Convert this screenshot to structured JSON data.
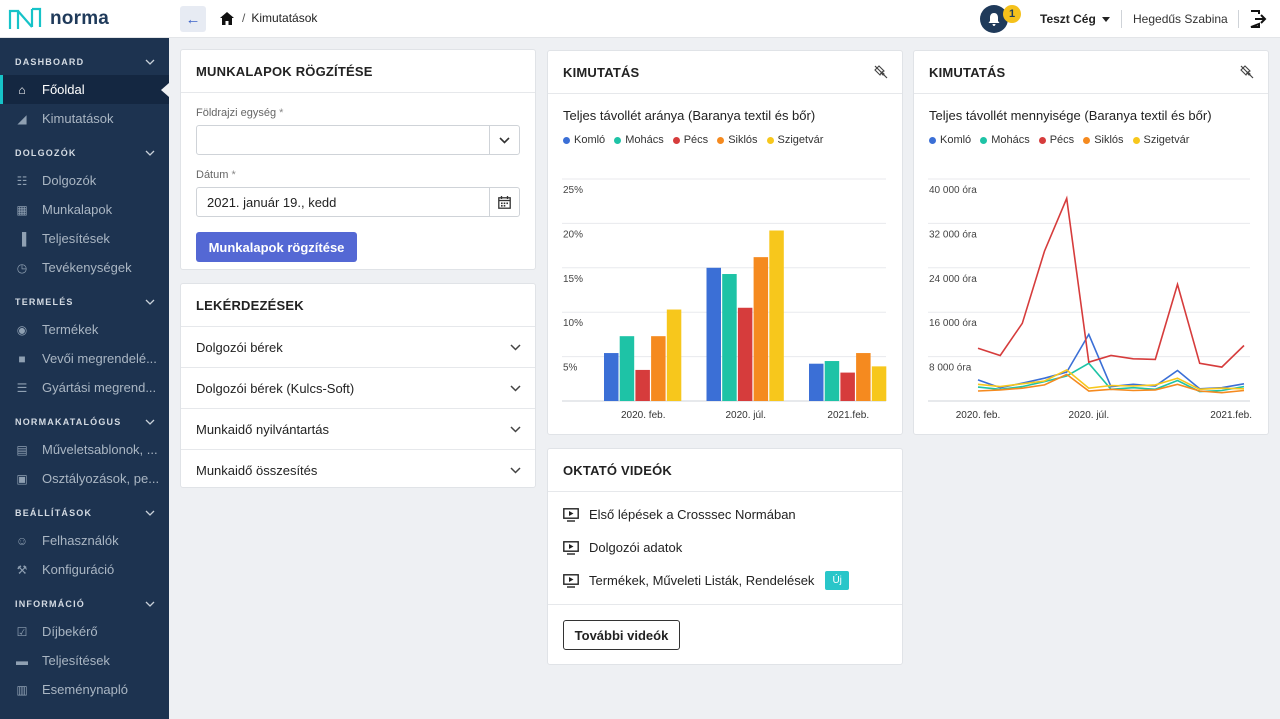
{
  "header": {
    "brand": "norma",
    "breadcrumb": "Kimutatások",
    "notification_count": "1",
    "company": "Teszt Cég",
    "user": "Hegedűs Szabina"
  },
  "sidebar": {
    "sections": [
      {
        "title": "DASHBOARD",
        "items": [
          {
            "label": "Főoldal",
            "icon": "home-icon",
            "active": true
          },
          {
            "label": "Kimutatások",
            "icon": "chart-area-icon"
          }
        ]
      },
      {
        "title": "DOLGOZÓK",
        "items": [
          {
            "label": "Dolgozók",
            "icon": "users-icon"
          },
          {
            "label": "Munkalapok",
            "icon": "calendar-icon"
          },
          {
            "label": "Teljesítések",
            "icon": "bar-chart-icon"
          },
          {
            "label": "Tevékenységek",
            "icon": "clock-icon"
          }
        ]
      },
      {
        "title": "TERMELÉS",
        "items": [
          {
            "label": "Termékek",
            "icon": "box-icon"
          },
          {
            "label": "Vevői megrendelé...",
            "icon": "file-icon"
          },
          {
            "label": "Gyártási megrend...",
            "icon": "list-icon"
          }
        ]
      },
      {
        "title": "NORMAKATALÓGUS",
        "items": [
          {
            "label": "Műveletsablonok, ...",
            "icon": "template-icon"
          },
          {
            "label": "Osztályozások, pe...",
            "icon": "classify-icon"
          }
        ]
      },
      {
        "title": "BEÁLLÍTÁSOK",
        "items": [
          {
            "label": "Felhasználók",
            "icon": "user-plus-icon"
          },
          {
            "label": "Konfiguráció",
            "icon": "wrench-icon"
          }
        ]
      },
      {
        "title": "INFORMÁCIÓ",
        "items": [
          {
            "label": "Díjbekérő",
            "icon": "invoice-icon"
          },
          {
            "label": "Teljesítések",
            "icon": "inbox-icon"
          },
          {
            "label": "Eseménynapló",
            "icon": "log-icon"
          }
        ]
      }
    ]
  },
  "worksheet": {
    "title": "MUNKALAPOK RÖGZÍTÉSE",
    "geo_label": "Földrajzi egység",
    "geo_value": "",
    "date_label": "Dátum",
    "date_value": "2021. január 19., kedd",
    "required_mark": "*",
    "submit": "Munkalapok rögzítése"
  },
  "queries": {
    "title": "LEKÉRDEZÉSEK",
    "items": [
      "Dolgozói bérek",
      "Dolgozói bérek (Kulcs-Soft)",
      "Munkaidő nyilvántartás",
      "Munkaidő összesítés"
    ]
  },
  "colors": {
    "Komló": "#3b6fd6",
    "Mohács": "#1ec3a6",
    "Pécs": "#d63c3c",
    "Siklós": "#f58a1f",
    "Szigetvár": "#f7c71c"
  },
  "chart_data": [
    {
      "type": "bar",
      "card_title": "KIMUTATÁS",
      "title": "Teljes távollét aránya (Baranya textil és bőr)",
      "categories": [
        "2020. feb.",
        "2020. júl.",
        "2021.feb."
      ],
      "ylim": [
        0,
        25
      ],
      "y_ticks": [
        "5%",
        "10%",
        "15%",
        "20%",
        "25%"
      ],
      "y_tick_values": [
        5,
        10,
        15,
        20,
        25
      ],
      "series": [
        {
          "name": "Komló",
          "values": [
            5.4,
            15.0,
            4.2
          ]
        },
        {
          "name": "Mohács",
          "values": [
            7.3,
            14.3,
            4.5
          ]
        },
        {
          "name": "Pécs",
          "values": [
            3.5,
            10.5,
            3.2
          ]
        },
        {
          "name": "Siklós",
          "values": [
            7.3,
            16.2,
            5.4
          ]
        },
        {
          "name": "Szigetvár",
          "values": [
            10.3,
            19.2,
            3.9
          ]
        }
      ]
    },
    {
      "type": "line",
      "card_title": "KIMUTATÁS",
      "title": "Teljes távollét mennyisége (Baranya textil és bőr)",
      "x_ticks": [
        "2020. feb.",
        "2020. júl.",
        "2021.feb."
      ],
      "x_tick_index": [
        1,
        6,
        11
      ],
      "ylim": [
        0,
        40000
      ],
      "y_ticks": [
        "8 000 óra",
        "16 000 óra",
        "24 000 óra",
        "32 000 óra",
        "40 000 óra"
      ],
      "y_tick_values": [
        8000,
        16000,
        24000,
        32000,
        40000
      ],
      "series": [
        {
          "name": "Komló",
          "values": [
            3800,
            2400,
            3200,
            4100,
            5200,
            12000,
            2600,
            3000,
            2700,
            5500,
            2200,
            2400,
            3100
          ]
        },
        {
          "name": "Mohács",
          "values": [
            2500,
            2100,
            2600,
            3500,
            4500,
            6800,
            2100,
            2400,
            2100,
            3700,
            1700,
            1900,
            2600
          ]
        },
        {
          "name": "Pécs",
          "values": [
            9500,
            8200,
            14000,
            27000,
            36500,
            7000,
            8200,
            7600,
            7500,
            21000,
            6800,
            6100,
            10000
          ]
        },
        {
          "name": "Siklós",
          "values": [
            1800,
            2000,
            2300,
            2900,
            4800,
            1800,
            2100,
            1900,
            2000,
            3000,
            1800,
            1500,
            1900
          ]
        },
        {
          "name": "Szigetvár",
          "values": [
            3000,
            2600,
            3100,
            3600,
            5600,
            2300,
            2800,
            2700,
            2900,
            4100,
            2100,
            2300,
            2200
          ]
        }
      ]
    }
  ],
  "videos": {
    "title": "OKTATÓ VIDEÓK",
    "items": [
      {
        "label": "Első lépések a Crosssec Normában",
        "badge": ""
      },
      {
        "label": "Dolgozói adatok",
        "badge": ""
      },
      {
        "label": "Termékek, Műveleti Listák, Rendelések",
        "badge": "Új"
      }
    ],
    "more": "További videók"
  }
}
